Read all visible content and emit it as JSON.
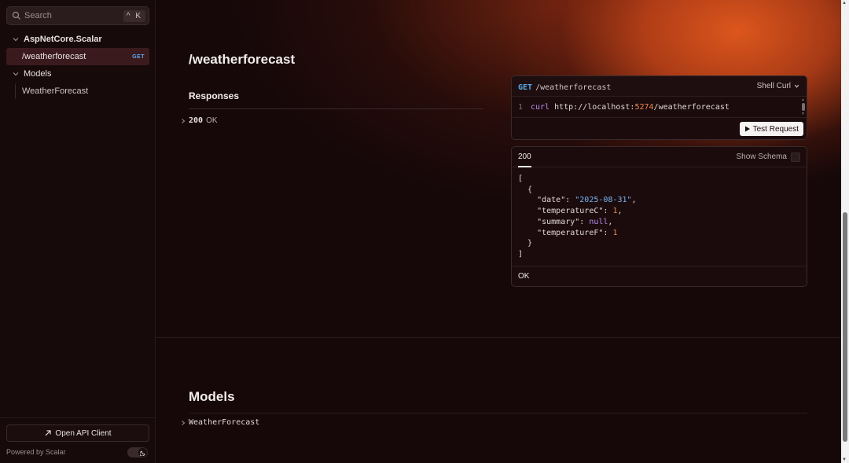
{
  "sidebar": {
    "search_placeholder": "Search",
    "search_shortcut": "^ K",
    "items": [
      {
        "label": "AspNetCore.Scalar"
      },
      {
        "label": "/weatherforecast",
        "badge": "GET"
      },
      {
        "label": "Models"
      },
      {
        "label": "WeatherForecast"
      }
    ],
    "open_client_label": "Open API Client",
    "powered_by": "Powered by Scalar"
  },
  "endpoint": {
    "title": "/weatherforecast",
    "responses_heading": "Responses",
    "response_code": "200",
    "response_label": "OK"
  },
  "request_card": {
    "method": "GET",
    "path": "/weatherforecast",
    "client_select": "Shell Curl",
    "line_number": "1",
    "command": "curl",
    "url_prefix": "http://localhost:",
    "url_port": "5274",
    "url_suffix": "/weatherforecast",
    "test_button": "Test Request"
  },
  "response_card": {
    "tab": "200",
    "show_schema": "Show Schema",
    "json": {
      "open_bracket": "[",
      "open_brace": "{",
      "k_date": "\"date\"",
      "v_date": "\"2025-08-31\"",
      "k_tc": "\"temperatureC\"",
      "v_tc": "1",
      "k_summary": "\"summary\"",
      "v_summary": "null",
      "k_tf": "\"temperatureF\"",
      "v_tf": "1",
      "close_brace": "}",
      "close_bracket": "]"
    },
    "footer": "OK"
  },
  "models": {
    "title": "Models",
    "items": [
      {
        "label": "WeatherForecast"
      }
    ]
  },
  "colors": {
    "accent": "#e0591e",
    "get_method": "#5aa8e8",
    "background": "#160809"
  }
}
